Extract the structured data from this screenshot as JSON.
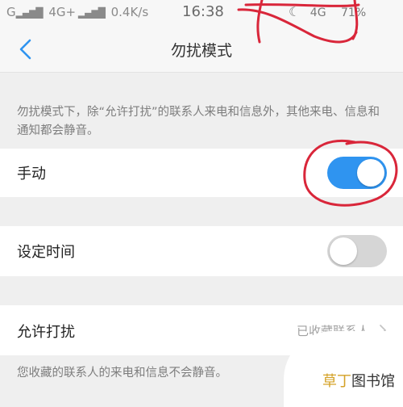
{
  "status_bar": {
    "carrier_left": "G",
    "network_left": "4G+",
    "speed": "0.4K/s",
    "time": "16:38",
    "network_right": "4G",
    "battery": "71%"
  },
  "nav": {
    "title": "勿扰模式"
  },
  "description": "勿扰模式下，除“允许打扰”的联系人来电和信息外，其他来电、信息和通知都会静音。",
  "rows": {
    "manual": {
      "label": "手动",
      "enabled": true
    },
    "schedule": {
      "label": "设定时间",
      "enabled": false
    },
    "allow": {
      "label": "允许打扰",
      "value": "已收藏联系人"
    }
  },
  "footnote": "您收藏的联系人的来电和信息不会静音。",
  "watermark": {
    "part1": "草丁",
    "part2": "图书馆"
  },
  "colors": {
    "toggle_on": "#2f94f0",
    "toggle_off": "#d6d6d6",
    "accent_back": "#2f94f0",
    "annotation": "#d9263a"
  }
}
